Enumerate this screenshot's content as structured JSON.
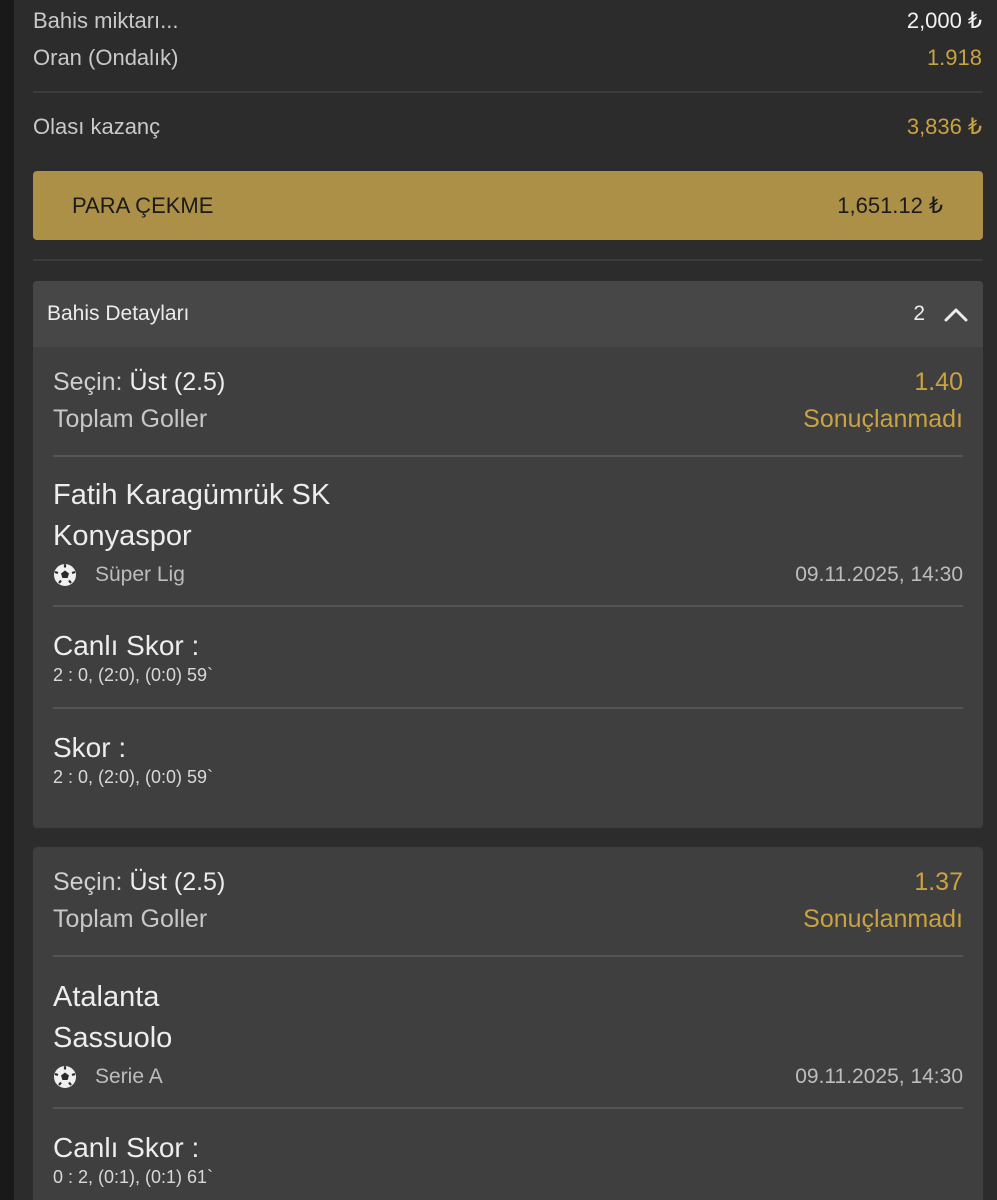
{
  "summary": {
    "stake_label": "Bahis miktarı...",
    "stake_value": "2,000 ₺",
    "odds_label": "Oran (Ondalık)",
    "odds_value": "1.918",
    "winnings_label": "Olası kazanç",
    "winnings_value": "3,836 ₺"
  },
  "cashout": {
    "label": "PARA ÇEKME",
    "amount": "1,651.12 ₺"
  },
  "details": {
    "title": "Bahis Detayları",
    "count": "2"
  },
  "selections": [
    {
      "pick_prefix": "Seçin:",
      "pick": "Üst (2.5)",
      "odds": "1.40",
      "market": "Toplam Goller",
      "status": "Sonuçlanmadı",
      "home": "Fatih Karagümrük SK",
      "away": "Konyaspor",
      "league": "Süper Lig",
      "datetime": "09.11.2025, 14:30",
      "live_score_label": "Canlı Skor :",
      "live_score": "2 : 0, (2:0), (0:0) 59`",
      "score_label": "Skor :",
      "score": "2 : 0, (2:0), (0:0) 59`"
    },
    {
      "pick_prefix": "Seçin:",
      "pick": "Üst (2.5)",
      "odds": "1.37",
      "market": "Toplam Goller",
      "status": "Sonuçlanmadı",
      "home": "Atalanta",
      "away": "Sassuolo",
      "league": "Serie A",
      "datetime": "09.11.2025, 14:30",
      "live_score_label": "Canlı Skor :",
      "live_score": "0 : 2, (0:1), (0:1) 61`"
    }
  ],
  "colors": {
    "accent_gold": "#c9a241",
    "cashout_bg": "#ad9048",
    "panel_bg": "#2c2c2c",
    "card_bg": "#3f3f3f"
  },
  "icons": {
    "sport": "soccer-ball-icon",
    "collapse": "chevron-up-icon"
  }
}
